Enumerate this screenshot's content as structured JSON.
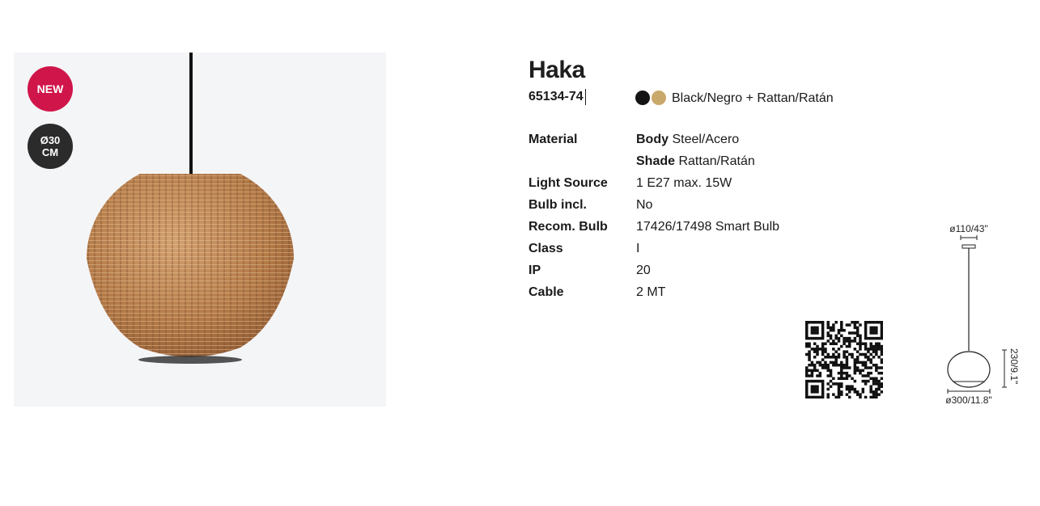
{
  "badges": {
    "new": "NEW",
    "size_line1": "Ø30",
    "size_line2": "CM"
  },
  "product": {
    "name": "Haka",
    "reference": "65134-74",
    "color_label": "Black/Negro + Rattan/Ratán",
    "swatches": [
      "#141414",
      "#c9a96b"
    ]
  },
  "specs": {
    "material": {
      "label": "Material",
      "body_key": "Body",
      "body_value": "Steel/Acero",
      "shade_key": "Shade",
      "shade_value": "Rattan/Ratán"
    },
    "light_source": {
      "label": "Light Source",
      "value": "1 E27 max. 15W"
    },
    "bulb_incl": {
      "label": "Bulb incl.",
      "value": "No"
    },
    "recom_bulb": {
      "label": "Recom. Bulb",
      "value": "17426/17498 Smart Bulb"
    },
    "class": {
      "label": "Class",
      "value": "I"
    },
    "ip": {
      "label": "IP",
      "value": "20"
    },
    "cable": {
      "label": "Cable",
      "value": "2 MT"
    }
  },
  "dimensions": {
    "canopy": "ø110/43\"",
    "height": "230/9.1\"",
    "diameter": "ø300/11.8\""
  }
}
